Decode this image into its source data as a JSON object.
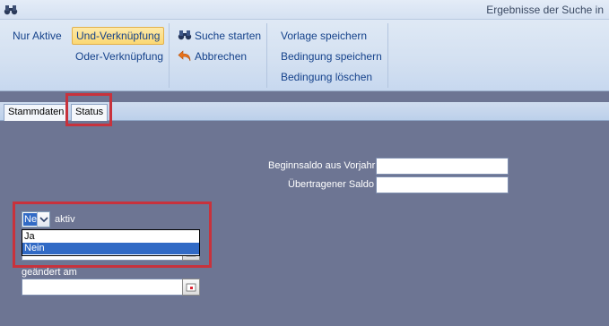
{
  "window": {
    "title": "Ergebnisse der Suche in",
    "app_icon": "binoculars-icon"
  },
  "ribbon": {
    "nur_aktive": "Nur Aktive",
    "und_verknuepfung": "Und-Verknüpfung",
    "oder_verknuepfung": "Oder-Verknüpfung",
    "suche_starten": "Suche starten",
    "abbrechen": "Abbrechen",
    "vorlage_speichern": "Vorlage speichern",
    "bedingung_speichern": "Bedingung speichern",
    "bedingung_loeschen": "Bedingung löschen"
  },
  "tabs": [
    {
      "label": "Stammdaten",
      "selected": false
    },
    {
      "label": "Status",
      "selected": true
    }
  ],
  "form": {
    "beginnsaldo_label": "Beginnsaldo aus Vorjahr",
    "beginnsaldo_value": "",
    "uebertragener_label": "Übertragener Saldo",
    "uebertragener_value": "",
    "aktiv_combo_value": "Ne",
    "aktiv_label": "aktiv",
    "aktiv_options": [
      "Ja",
      "Nein"
    ],
    "aktiv_highlighted_option": "Nein",
    "geaendert_label": "geändert am",
    "geaendert_value": ""
  },
  "colors": {
    "background": "#6d7593",
    "highlight_box": "#c8323c",
    "selection": "#316ac5"
  }
}
